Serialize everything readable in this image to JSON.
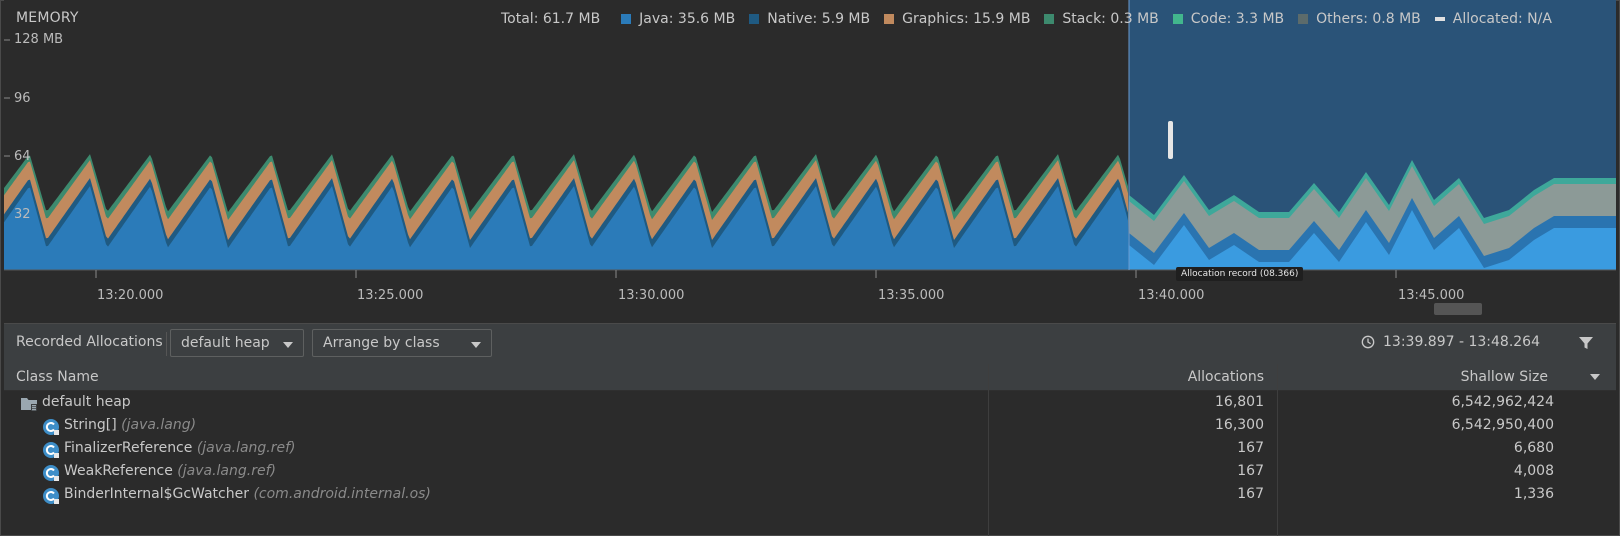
{
  "memory": {
    "title": "MEMORY",
    "total": "Total: 61.7 MB",
    "legend": [
      {
        "label": "Java: 35.6 MB",
        "color": "#2b7bb9",
        "icon": "java-swatch"
      },
      {
        "label": "Native: 5.9 MB",
        "color": "#1f5a82",
        "icon": "native-swatch"
      },
      {
        "label": "Graphics: 15.9 MB",
        "color": "#c18a5e",
        "icon": "graphics-swatch"
      },
      {
        "label": "Stack: 0.3 MB",
        "color": "#3d8a6e",
        "icon": "stack-swatch"
      },
      {
        "label": "Code: 3.3 MB",
        "color": "#42b68d",
        "icon": "code-swatch"
      },
      {
        "label": "Others: 0.8 MB",
        "color": "#5c6b6b",
        "icon": "others-swatch"
      },
      {
        "label": "Allocated: N/A",
        "color": "#e0e0e0",
        "icon": "allocated-dash"
      }
    ],
    "y_ticks": [
      "128 MB",
      "96",
      "64",
      "32"
    ],
    "x_ticks": [
      "13:20.000",
      "13:25.000",
      "13:30.000",
      "13:35.000",
      "13:40.000",
      "13:45.000"
    ],
    "allocation_record": "Allocation record (08.366)"
  },
  "toolbar": {
    "label": "Recorded Allocations",
    "heap_select": "default heap",
    "arrange_select": "Arrange by class",
    "time_range": "13:39.897 - 13:48.264"
  },
  "table": {
    "headers": {
      "class_name": "Class Name",
      "allocations": "Allocations",
      "shallow_size": "Shallow Size"
    },
    "rows": [
      {
        "name": "default heap",
        "pkg": "",
        "allocations": "16,801",
        "shallow": "6,542,962,424"
      },
      {
        "name": "String[]",
        "pkg": "(java.lang)",
        "allocations": "16,300",
        "shallow": "6,542,950,400"
      },
      {
        "name": "FinalizerReference",
        "pkg": "(java.lang.ref)",
        "allocations": "167",
        "shallow": "6,680"
      },
      {
        "name": "WeakReference",
        "pkg": "(java.lang.ref)",
        "allocations": "167",
        "shallow": "4,008"
      },
      {
        "name": "BinderInternal$GcWatcher",
        "pkg": "(com.android.internal.os)",
        "allocations": "167",
        "shallow": "1,336"
      }
    ]
  }
}
